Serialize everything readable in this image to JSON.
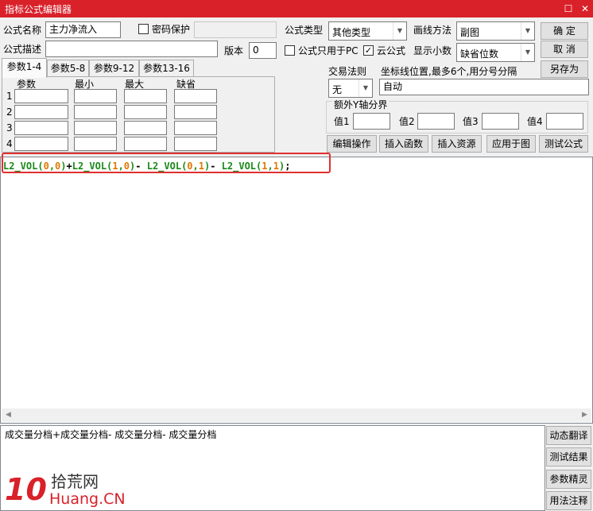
{
  "window": {
    "title": "指标公式编辑器",
    "restore_glyph": "☐",
    "close_glyph": "✕"
  },
  "form": {
    "name_label": "公式名称",
    "name_value": "主力净流入",
    "password_label": "密码保护",
    "password_checked": false,
    "type_label": "公式类型",
    "type_value": "其他类型",
    "draw_label": "画线方法",
    "draw_value": "副图",
    "desc_label": "公式描述",
    "desc_value": "",
    "version_label": "版本",
    "version_value": "0",
    "pc_only_label": "公式只用于PC",
    "pc_only_checked": false,
    "cloud_label": "云公式",
    "cloud_checked": true,
    "decimals_label": "显示小数",
    "decimals_value": "缺省位数",
    "trade_rule_label": "交易法则",
    "trade_rule_value": "无",
    "coord_label": "坐标线位置,最多6个,用分号分隔",
    "coord_value": "自动",
    "extra_y_label": "额外Y轴分界",
    "y_values": [
      {
        "label": "值1",
        "value": ""
      },
      {
        "label": "值2",
        "value": ""
      },
      {
        "label": "值3",
        "value": ""
      },
      {
        "label": "值4",
        "value": ""
      }
    ]
  },
  "buttons": {
    "ok": "确  定",
    "cancel": "取  消",
    "save_as": "另存为",
    "edit_op": "编辑操作",
    "insert_func": "插入函数",
    "insert_res": "插入资源",
    "apply_chart": "应用于图",
    "test_formula": "测试公式"
  },
  "tabs": [
    "参数1-4",
    "参数5-8",
    "参数9-12",
    "参数13-16"
  ],
  "params": {
    "headers": [
      "参数",
      "最小",
      "最大",
      "缺省"
    ],
    "rows": [
      "1",
      "2",
      "3",
      "4"
    ]
  },
  "editor": {
    "code_tokens": [
      {
        "t": "L2_VOL(",
        "c": "#1a8a1a"
      },
      {
        "t": "0",
        "c": "#e07800"
      },
      {
        "t": ",",
        "c": "#1a8a1a"
      },
      {
        "t": "0",
        "c": "#e07800"
      },
      {
        "t": ")",
        "c": "#1a8a1a"
      },
      {
        "t": "+",
        "c": "#000000"
      },
      {
        "t": "L2_VOL(",
        "c": "#1a8a1a"
      },
      {
        "t": "1",
        "c": "#e07800"
      },
      {
        "t": ",",
        "c": "#1a8a1a"
      },
      {
        "t": "0",
        "c": "#e07800"
      },
      {
        "t": ")",
        "c": "#1a8a1a"
      },
      {
        "t": "- ",
        "c": "#000000"
      },
      {
        "t": "L2_VOL(",
        "c": "#1a8a1a"
      },
      {
        "t": "0",
        "c": "#e07800"
      },
      {
        "t": ",",
        "c": "#1a8a1a"
      },
      {
        "t": "1",
        "c": "#e07800"
      },
      {
        "t": ")",
        "c": "#1a8a1a"
      },
      {
        "t": "- ",
        "c": "#000000"
      },
      {
        "t": "L2_VOL(",
        "c": "#1a8a1a"
      },
      {
        "t": "1",
        "c": "#e07800"
      },
      {
        "t": ",",
        "c": "#1a8a1a"
      },
      {
        "t": "1",
        "c": "#e07800"
      },
      {
        "t": ")",
        "c": "#1a8a1a"
      },
      {
        "t": ";",
        "c": "#000000"
      }
    ],
    "highlight_color": "#e03030"
  },
  "output": {
    "translation": "成交量分档+成交量分档- 成交量分档- 成交量分档"
  },
  "side_buttons": [
    "动态翻译",
    "测试结果",
    "参数精灵",
    "用法注释"
  ],
  "watermark": {
    "logo_text": "10",
    "cn_text": "拾荒网",
    "en_text": "Huang.CN"
  },
  "colors": {
    "titlebar": "#d9212a",
    "code_function": "#1a8a1a",
    "code_number": "#e07800",
    "watermark_red": "#d9212a"
  }
}
